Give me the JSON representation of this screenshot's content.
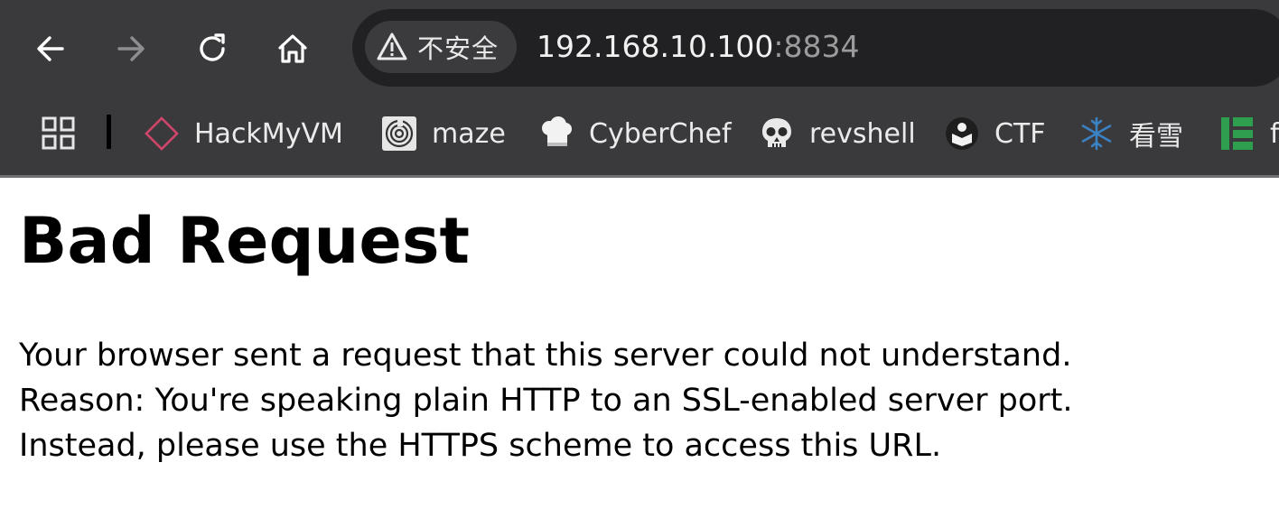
{
  "browser": {
    "nav": {
      "back_icon": "arrow-left-icon",
      "forward_icon": "arrow-right-icon",
      "reload_icon": "reload-icon",
      "home_icon": "home-icon"
    },
    "omnibox": {
      "security_label": "不安全",
      "security_icon": "warning-triangle-icon",
      "url_host": "192.168.10.100",
      "url_port": ":8834"
    },
    "bookmarks": [
      {
        "label": "HackMyVM",
        "icon": "diamond-icon"
      },
      {
        "label": "maze",
        "icon": "maze-icon"
      },
      {
        "label": "CyberChef",
        "icon": "chef-hat-icon"
      },
      {
        "label": "revshell",
        "icon": "skull-icon"
      },
      {
        "label": "CTF",
        "icon": "ctf-logo-icon"
      },
      {
        "label": "看雪",
        "icon": "snowflake-icon"
      },
      {
        "label": "f",
        "icon": "green-logo-icon"
      }
    ],
    "colors": {
      "chrome_bg": "#3a3a3d",
      "omnibox_bg": "#212124",
      "accent_pink": "#d2456a",
      "snowflake_blue": "#3b82c4",
      "green": "#2e9e4f"
    }
  },
  "page": {
    "title": "Bad Request",
    "lines": [
      "Your browser sent a request that this server could not understand.",
      "Reason: You're speaking plain HTTP to an SSL-enabled server port.",
      "Instead, please use the HTTPS scheme to access this URL."
    ]
  }
}
